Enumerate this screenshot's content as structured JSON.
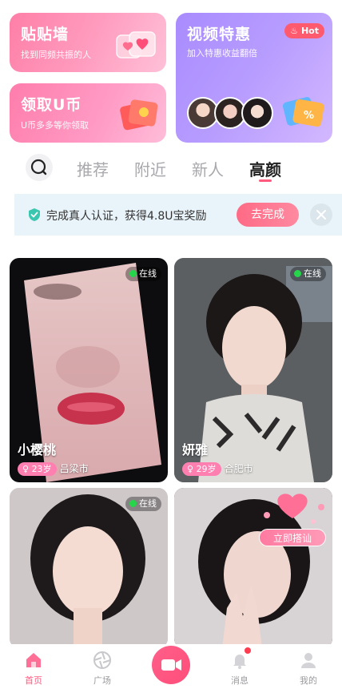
{
  "promo_cards": {
    "tiepiqiang": {
      "title": "贴贴墙",
      "subtitle": "找到同频共振的人"
    },
    "lingqu_ucoin": {
      "title": "领取U币",
      "subtitle": "U币多多等你领取"
    },
    "video_special": {
      "title": "视频特惠",
      "subtitle": "加入特惠收益翻倍",
      "badge": "Hot"
    }
  },
  "tabs": [
    "推荐",
    "附近",
    "新人",
    "高颜"
  ],
  "active_tab": "高颜",
  "verify_banner": {
    "text": "完成真人认证，获得4.8U宝奖励",
    "button": "去完成"
  },
  "profiles": [
    {
      "name": "小樱桃",
      "age": "23岁",
      "city": "吕梁市",
      "status": "在线"
    },
    {
      "name": "妍雅",
      "age": "29岁",
      "city": "合肥市",
      "status": "在线"
    },
    {
      "status": "在线"
    },
    {
      "action": "立即搭讪"
    }
  ],
  "bottom_nav": [
    {
      "label": "首页",
      "icon": "home-icon"
    },
    {
      "label": "广场",
      "icon": "aperture-icon"
    },
    {
      "icon": "video-camera-icon"
    },
    {
      "label": "消息",
      "icon": "bell-icon"
    },
    {
      "label": "我的",
      "icon": "user-icon"
    }
  ],
  "colors": {
    "accent": "#ff5b7f",
    "online": "#25d64a",
    "banner_bg": "#e9f4fa"
  }
}
